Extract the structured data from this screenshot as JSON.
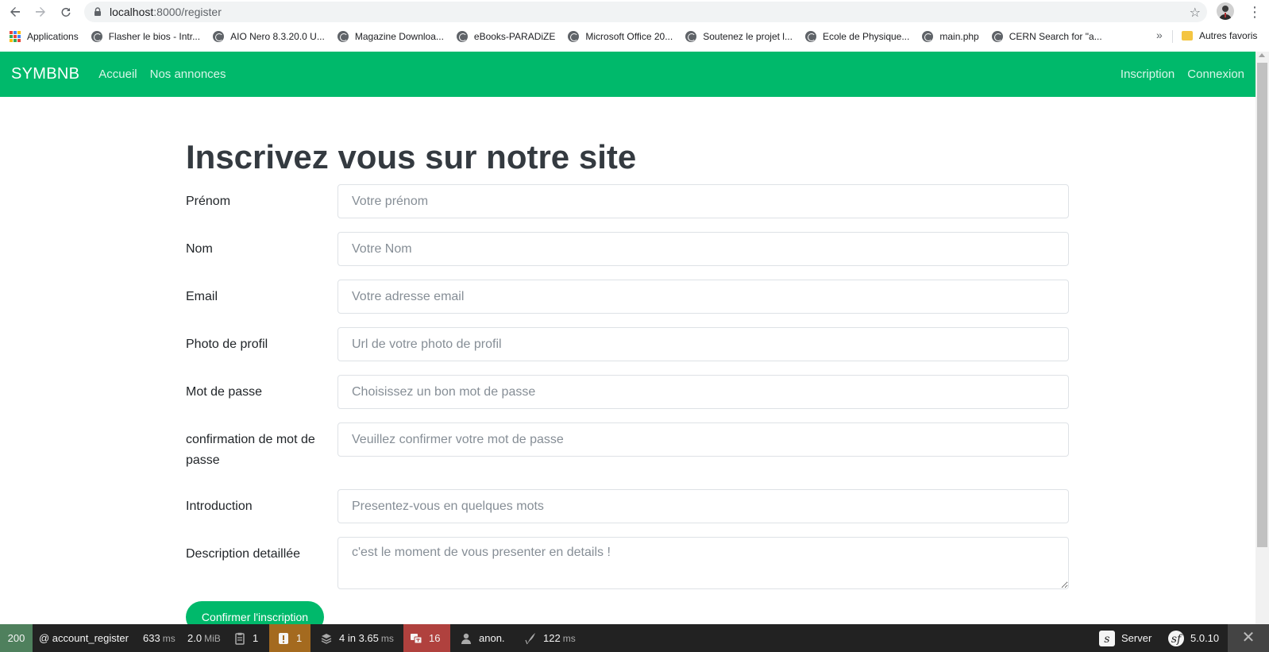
{
  "browser": {
    "url_host": "localhost",
    "url_path": ":8000/register",
    "back_icon": "back-arrow-icon",
    "forward_icon": "forward-arrow-icon",
    "reload_icon": "reload-icon",
    "lock_icon": "lock-icon",
    "star_icon": "star-icon",
    "menu_icon": "kebab-menu-icon",
    "bookmarks": [
      "Applications",
      "Flasher le bios - Intr...",
      "AIO Nero 8.3.20.0 U...",
      "Magazine Downloa...",
      "eBooks-PARADiZE",
      "Microsoft Office 20...",
      "Soutenez le projet l...",
      "Ecole de Physique...",
      "main.php",
      "CERN Search for \"a..."
    ],
    "bookmarks_more": "»",
    "other_bookmarks": "Autres favoris"
  },
  "navbar": {
    "brand": "SYMBNB",
    "links_left": [
      "Accueil",
      "Nos annonces"
    ],
    "links_right": [
      "Inscription",
      "Connexion"
    ],
    "color": "#00b96b"
  },
  "form": {
    "title": "Inscrivez vous sur notre site",
    "fields": [
      {
        "label": "Prénom",
        "placeholder": "Votre prénom"
      },
      {
        "label": "Nom",
        "placeholder": "Votre Nom"
      },
      {
        "label": "Email",
        "placeholder": "Votre adresse email"
      },
      {
        "label": "Photo de profil",
        "placeholder": "Url de votre photo de profil"
      },
      {
        "label": "Mot de passe",
        "placeholder": "Choisissez un bon mot de passe"
      },
      {
        "label": "confirmation de mot de passe",
        "placeholder": "Veuillez confirmer votre mot de passe"
      },
      {
        "label": "Introduction",
        "placeholder": "Presentez-vous en quelques mots"
      },
      {
        "label": "Description detaillée",
        "placeholder": "c'est le moment de vous presenter en details !"
      }
    ],
    "submit_label": "Confirmer l'inscription"
  },
  "toolbar": {
    "status": "200",
    "route": "@ account_register",
    "time_value": "633",
    "time_unit": "ms",
    "memory_value": "2.0",
    "memory_unit": "MiB",
    "forms_count": "1",
    "warnings_count": "1",
    "templates": "4",
    "templates_in": "in 3.65",
    "templates_unit": "ms",
    "translation_count": "16",
    "user": "anon.",
    "events_value": "122",
    "events_unit": "ms",
    "server_label": "Server",
    "version": "5.0.10",
    "close_icon": "close-icon"
  }
}
